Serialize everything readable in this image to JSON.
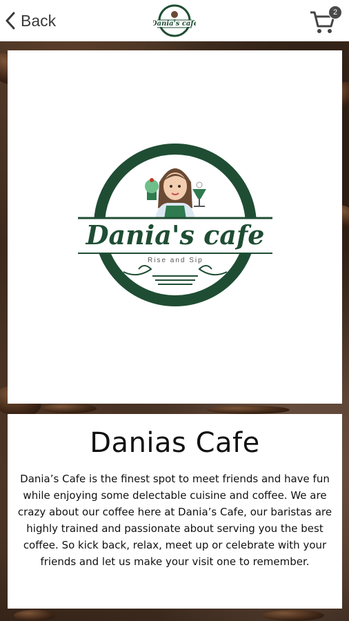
{
  "header": {
    "back_label": "Back",
    "cart_count": "2",
    "logo_text": "Dania's cafe"
  },
  "logo": {
    "brand_name": "Dania's cafe",
    "tagline": "Rise and Sip",
    "brand_color": "#1f4d33"
  },
  "content": {
    "title": "Danias Cafe",
    "description": "Dania’s Cafe is the finest spot to meet friends and have fun while enjoying some delectable cuisine and coffee. We are crazy about our coffee here at Dania’s Cafe, our baristas are highly trained and passionate about serving you the best coffee. So kick back, relax, meet up or celebrate with your friends and let us make your visit one to remember."
  },
  "icons": {
    "back": "chevron-left-icon",
    "cart": "shopping-cart-icon"
  }
}
